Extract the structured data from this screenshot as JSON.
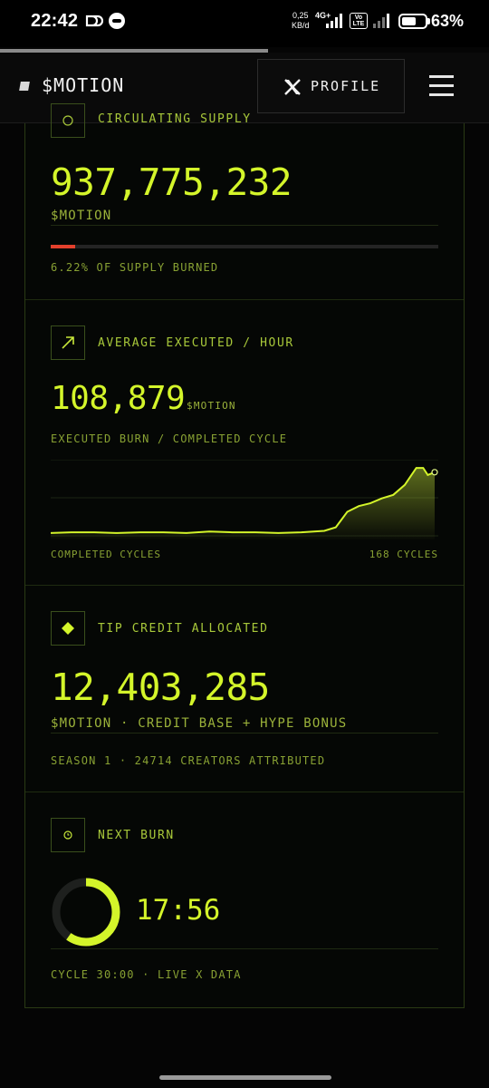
{
  "status_bar": {
    "time": "22:42",
    "speed_value": "0,25",
    "speed_unit": "KB/d",
    "network": "4G+",
    "volte": "Vo LTE",
    "battery_pct": "63%",
    "battery_level": 0.63
  },
  "header": {
    "brand": "$MOTION",
    "profile_label": "PROFILE",
    "profile_icon": "x-logo-icon",
    "menu_icon": "hamburger-menu-icon"
  },
  "supply": {
    "label": "CIRCULATING SUPPLY",
    "value": "937,775,232",
    "unit": "$MOTION",
    "burn_fraction": 0.0622,
    "burned_text": "6.22% OF SUPPLY BURNED"
  },
  "average": {
    "label": "AVERAGE EXECUTED / HOUR",
    "value": "108,879",
    "unit": "$MOTION",
    "subtitle": "EXECUTED BURN / COMPLETED CYCLE",
    "chart_left_label": "COMPLETED CYCLES",
    "chart_right_label": "168 CYCLES"
  },
  "tip": {
    "label": "TIP CREDIT ALLOCATED",
    "value": "12,403,285",
    "unit": "$MOTION · CREDIT BASE + HYPE BONUS",
    "footer": "SEASON 1 · 24714 CREATORS ATTRIBUTED"
  },
  "next_burn": {
    "label": "NEXT BURN",
    "timer": "17:56",
    "footer": "CYCLE 30:00 · LIVE X DATA",
    "remaining_fraction": 0.598
  },
  "colors": {
    "accent": "#d4f52a",
    "burn_red": "#e4402c"
  },
  "chart_data": {
    "type": "area",
    "x": [
      1,
      10,
      20,
      30,
      40,
      50,
      60,
      70,
      80,
      90,
      100,
      110,
      120,
      125,
      130,
      135,
      140,
      145,
      150,
      155,
      160,
      163,
      165,
      168
    ],
    "values": [
      4,
      5,
      5,
      4,
      5,
      5,
      4,
      6,
      5,
      5,
      4,
      5,
      7,
      12,
      34,
      42,
      46,
      53,
      58,
      72,
      96,
      96,
      86,
      90
    ],
    "xlabel": "",
    "ylabel": "",
    "ylim": [
      0,
      100
    ],
    "grid": true
  }
}
